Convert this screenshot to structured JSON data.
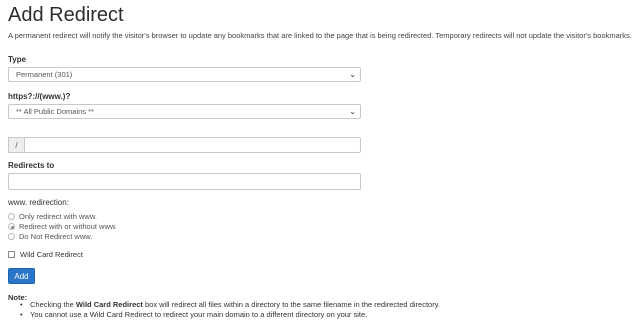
{
  "header": {
    "title": "Add Redirect",
    "description": "A permanent redirect will notify the visitor's browser to update any bookmarks that are linked to the page that is being redirected. Temporary redirects will not update the visitor's bookmarks."
  },
  "type_field": {
    "label": "Type",
    "selected": "Permanent (301)"
  },
  "domain_field": {
    "label": "https?://(www.)?",
    "selected": "** All Public Domains **"
  },
  "path_field": {
    "prefix": "/",
    "value": ""
  },
  "redirects_to": {
    "label": "Redirects to",
    "value": ""
  },
  "www_redirection": {
    "label": "www. redirection:",
    "options": [
      {
        "label": "Only redirect with www.",
        "checked": false
      },
      {
        "label": "Redirect with or without www.",
        "checked": true
      },
      {
        "label": "Do Not Redirect www.",
        "checked": false
      }
    ]
  },
  "wildcard": {
    "label": "Wild Card Redirect",
    "checked": false
  },
  "add_button": {
    "label": "Add"
  },
  "note": {
    "title": "Note:",
    "item1_pre": "Checking the ",
    "item1_bold": "Wild Card Redirect",
    "item1_post": " box will redirect all files within a directory to the same filename in the redirected directory.",
    "item2": "You cannot use a Wild Card Redirect to redirect your main domain to a different directory on your site."
  }
}
